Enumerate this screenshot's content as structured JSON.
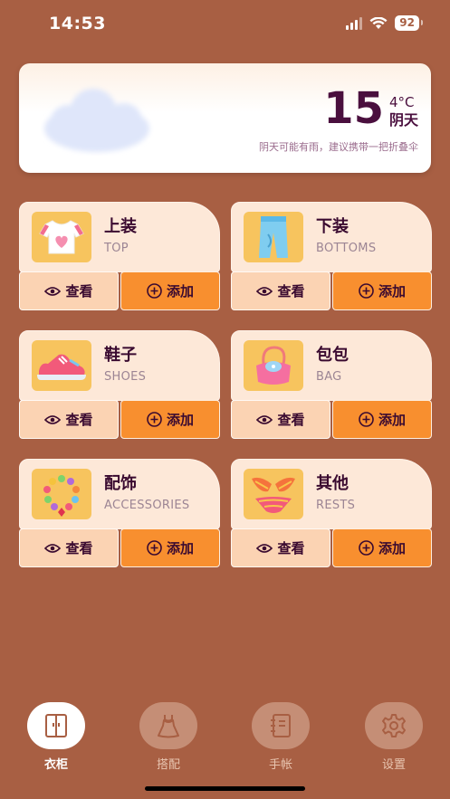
{
  "status_bar": {
    "time": "14:53",
    "battery": "92"
  },
  "weather": {
    "temperature": "15",
    "unit": "4°C",
    "condition": "阴天",
    "advice": "阴天可能有雨，建议携带一把折叠伞"
  },
  "categories": [
    {
      "title": "上装",
      "subtitle": "TOP",
      "view": "查看",
      "add": "添加"
    },
    {
      "title": "下装",
      "subtitle": "BOTTOMS",
      "view": "查看",
      "add": "添加"
    },
    {
      "title": "鞋子",
      "subtitle": "SHOES",
      "view": "查看",
      "add": "添加"
    },
    {
      "title": "包包",
      "subtitle": "BAG",
      "view": "查看",
      "add": "添加"
    },
    {
      "title": "配饰",
      "subtitle": "ACCESSORIES",
      "view": "查看",
      "add": "添加"
    },
    {
      "title": "其他",
      "subtitle": "RESTS",
      "view": "查看",
      "add": "添加"
    }
  ],
  "tabs": [
    {
      "label": "衣柜",
      "icon": "wardrobe-icon",
      "active": true
    },
    {
      "label": "搭配",
      "icon": "dress-icon",
      "active": false
    },
    {
      "label": "手帐",
      "icon": "notebook-icon",
      "active": false
    },
    {
      "label": "设置",
      "icon": "gear-icon",
      "active": false
    }
  ],
  "colors": {
    "background": "#a85f43",
    "card": "#fde8d8",
    "view_button": "#fbd3b3",
    "add_button": "#f88f2f",
    "text_dark": "#3a0a30"
  }
}
